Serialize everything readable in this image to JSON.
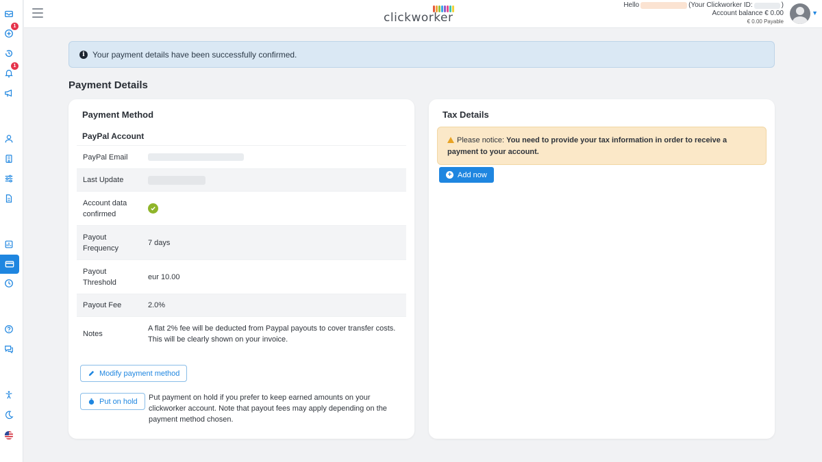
{
  "sidebar": {
    "icons": [
      {
        "name": "inbox-icon",
        "badge": null
      },
      {
        "name": "add-circle-icon",
        "badge": "1"
      },
      {
        "name": "history-icon",
        "badge": null
      },
      {
        "name": "notification-icon",
        "badge": "1"
      },
      {
        "name": "megaphone-icon",
        "badge": null
      },
      {
        "name": "user-icon",
        "badge": null
      },
      {
        "name": "building-icon",
        "badge": null
      },
      {
        "name": "sliders-icon",
        "badge": null
      },
      {
        "name": "document-icon",
        "badge": null
      },
      {
        "name": "report-icon",
        "badge": null
      },
      {
        "name": "credit-card-icon",
        "badge": null,
        "active": true
      },
      {
        "name": "clock-icon",
        "badge": null
      },
      {
        "name": "help-icon",
        "badge": null
      },
      {
        "name": "chat-icon",
        "badge": null
      },
      {
        "name": "accessibility-icon",
        "badge": null
      },
      {
        "name": "moon-icon",
        "badge": null
      },
      {
        "name": "us-flag-icon",
        "badge": null
      }
    ]
  },
  "header": {
    "logo_text": "clickworker",
    "hello": "Hello",
    "worker_id_prefix": "(Your Clickworker ID:",
    "worker_id_suffix": ")",
    "balance": "Account balance € 0.00",
    "payable": "€ 0.00 Payable"
  },
  "alert": {
    "message": "Your payment details have been successfully confirmed."
  },
  "page_title": "Payment Details",
  "payment": {
    "card_title": "Payment Method",
    "account_title": "PayPal Account",
    "rows": [
      {
        "label": "PayPal Email",
        "value": ""
      },
      {
        "label": "Last Update",
        "value": ""
      },
      {
        "label": "Account data confirmed",
        "value": ""
      },
      {
        "label": "Payout Frequency",
        "value": "7 days"
      },
      {
        "label": "Payout Threshold",
        "value": "eur 10.00"
      },
      {
        "label": "Payout Fee",
        "value": "2.0%"
      },
      {
        "label": "Notes",
        "value": "A flat 2% fee will be deducted from Paypal payouts to cover transfer costs. This will be clearly shown on your invoice."
      }
    ],
    "modify_label": "Modify payment method",
    "hold_label": "Put on hold",
    "hold_text": "Put payment on hold if you prefer to keep earned amounts on your clickworker account. Note that payout fees may apply depending on the payment method chosen."
  },
  "tax": {
    "card_title": "Tax Details",
    "notice_prefix": "Please notice:",
    "notice_bold": "You need to provide your tax information in order to receive a payment to your account.",
    "add_label": "Add now"
  },
  "colors": {
    "accent": "#1f86e0",
    "alert_bg": "#dae8f4",
    "notice_bg": "#fbe8c8",
    "check": "#8fb52a",
    "badge": "#e5334b"
  }
}
